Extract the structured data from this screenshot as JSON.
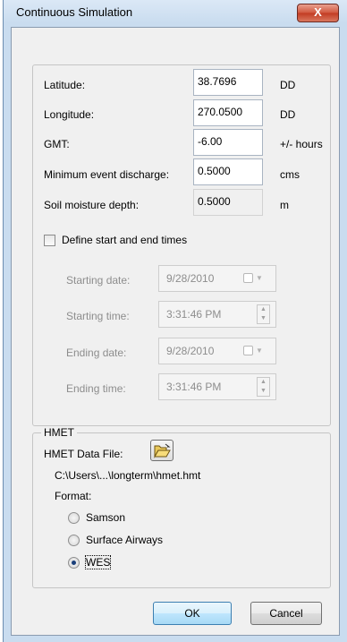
{
  "window": {
    "title": "Continuous Simulation",
    "close_glyph": "X"
  },
  "fields": [
    {
      "label": "Latitude:",
      "value": "38.7696",
      "unit": "DD",
      "readonly": false
    },
    {
      "label": "Longitude:",
      "value": "270.0500",
      "unit": "DD",
      "readonly": false
    },
    {
      "label": "GMT:",
      "value": "-6.00",
      "unit": "+/- hours",
      "readonly": false
    },
    {
      "label": "Minimum event discharge:",
      "value": "0.5000",
      "unit": "cms",
      "readonly": false
    },
    {
      "label": "Soil moisture depth:",
      "value": "0.5000",
      "unit": "m",
      "readonly": true
    }
  ],
  "define_times": {
    "label": "Define start and end times",
    "checked": false
  },
  "times": {
    "starting_date": {
      "label": "Starting date:",
      "value": "9/28/2010"
    },
    "starting_time": {
      "label": "Starting time:",
      "value": "3:31:46 PM"
    },
    "ending_date": {
      "label": "Ending date:",
      "value": "9/28/2010"
    },
    "ending_time": {
      "label": "Ending time:",
      "value": "3:31:46 PM"
    }
  },
  "hmet": {
    "group_title": "HMET",
    "data_file_label": "HMET Data File:",
    "path": "C:\\Users\\...\\longterm\\hmet.hmt",
    "format_label": "Format:",
    "formats": [
      {
        "label": "Samson",
        "selected": false
      },
      {
        "label": "Surface Airways",
        "selected": false
      },
      {
        "label": "WES",
        "selected": true
      }
    ]
  },
  "buttons": {
    "ok": "OK",
    "cancel": "Cancel"
  },
  "colors": {
    "accent": "#3c7fb1",
    "close_button": "#c23b22",
    "dialog_bg": "#f0f0f0"
  },
  "icons": {
    "close": "close-icon",
    "folder": "open-folder-icon",
    "calendar": "calendar-dropdown-icon",
    "spinner": "spinner-icon"
  }
}
